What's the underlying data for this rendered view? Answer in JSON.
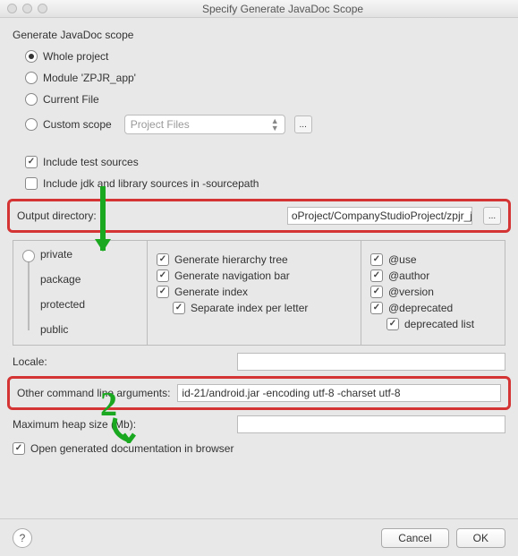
{
  "window": {
    "title": "Specify Generate JavaDoc Scope"
  },
  "scope": {
    "group_label": "Generate JavaDoc scope",
    "whole_project": "Whole project",
    "module": "Module 'ZPJR_app'",
    "current_file": "Current File",
    "custom_scope": "Custom scope",
    "combo_value": "Project Files",
    "ellipsis": "..."
  },
  "includes": {
    "test_sources": "Include test sources",
    "jdk_library": "Include jdk and library sources in -sourcepath"
  },
  "output": {
    "label": "Output directory:",
    "value": "oProject/CompanyStudioProject/zpjr_javadoc",
    "ellipsis": "..."
  },
  "visibility": {
    "private": "private",
    "package": "package",
    "protected": "protected",
    "public": "public"
  },
  "options_mid": {
    "hierarchy": "Generate hierarchy tree",
    "navbar": "Generate navigation bar",
    "index": "Generate index",
    "sep_index": "Separate index per letter"
  },
  "options_right": {
    "use": "@use",
    "author": "@author",
    "version": "@version",
    "deprecated": "@deprecated",
    "deprecated_list": "deprecated list"
  },
  "locale": {
    "label": "Locale:",
    "value": ""
  },
  "cmdargs": {
    "label": "Other command line arguments:",
    "value": "id-21/android.jar -encoding utf-8 -charset utf-8"
  },
  "heap": {
    "label": "Maximum heap size (Mb):",
    "value": ""
  },
  "open_doc": "Open generated documentation in browser",
  "buttons": {
    "cancel": "Cancel",
    "ok": "OK",
    "help": "?"
  }
}
